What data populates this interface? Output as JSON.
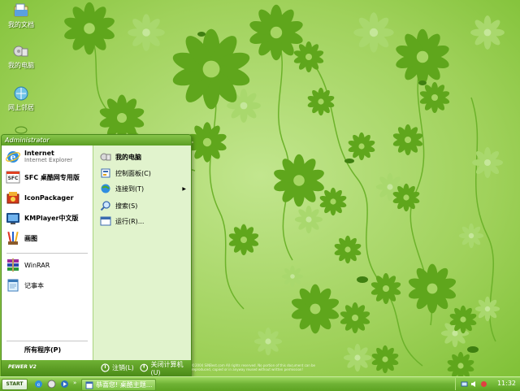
{
  "desktop": {
    "icons": [
      {
        "label": "我的文档",
        "icon": "my-documents-icon"
      },
      {
        "label": "我的电脑",
        "icon": "my-computer-icon"
      },
      {
        "label": "网上邻居",
        "icon": "network-neighborhood-icon"
      }
    ],
    "copyright": "©2004 SiNBest.com All rights reserved. No portion of this document can be reproduced, copied or in anyway reused without written permission!"
  },
  "start_menu": {
    "user": "Administrator",
    "pinned": [
      {
        "title": "Internet",
        "subtitle": "Internet Explorer",
        "icon": "internet-explorer-icon"
      },
      {
        "title": "SFC 桌酷网专用版",
        "icon": "sfc-icon"
      },
      {
        "title": "IconPackager",
        "icon": "iconpackager-icon"
      },
      {
        "title": "KMPlayer中文版",
        "icon": "kmplayer-icon"
      },
      {
        "title": "画图",
        "icon": "paint-icon"
      }
    ],
    "recent": [
      {
        "title": "WinRAR",
        "icon": "winrar-icon"
      },
      {
        "title": "记事本",
        "icon": "notepad-icon"
      }
    ],
    "all_programs": "所有程序(P)",
    "right": [
      {
        "label": "我的电脑",
        "icon": "my-computer-icon"
      },
      {
        "label": "控制面板(C)",
        "icon": "control-panel-icon"
      },
      {
        "label": "连接到(T)",
        "icon": "connect-to-icon"
      },
      {
        "label": "搜索(S)",
        "icon": "search-icon"
      },
      {
        "label": "运行(R)...",
        "icon": "run-icon"
      }
    ],
    "footer": {
      "brand": "PEWER V2",
      "logoff": "注销(L)",
      "shutdown": "关闭计算机(U)"
    }
  },
  "taskbar": {
    "start_label": "START",
    "window_button": "恭喜您! 桌酷主题...",
    "clock": "11:32"
  },
  "colors": {
    "wallpaper": "#8dc63f",
    "flower": "#5fa61c",
    "taskbar": "#6eb234"
  }
}
